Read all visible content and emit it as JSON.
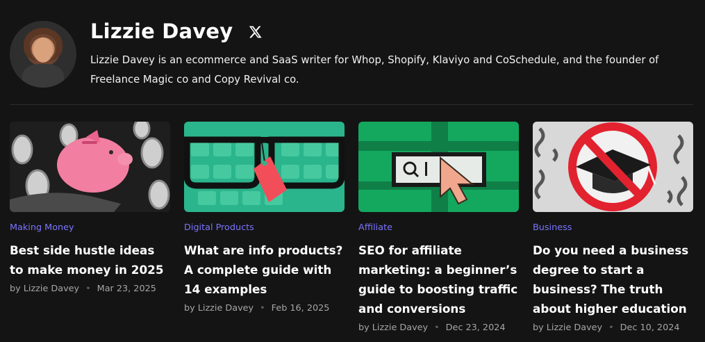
{
  "author": {
    "name": "Lizzie Davey",
    "bio": "Lizzie Davey is an ecommerce and SaaS writer for Whop, Shopify, Klaviyo and CoSchedule, and the founder of Freelance Magic co and Copy Revival co.",
    "social_icon": "x-icon"
  },
  "posts": [
    {
      "category": "Making Money",
      "title": "Best side hustle ideas to make money in 2025",
      "author": "by Lizzie Davey",
      "separator": "•",
      "date": "Mar 23, 2025",
      "image": "piggy-bank-illustration"
    },
    {
      "category": "Digital Products",
      "title": "What are info products? A complete guide with 14 examples",
      "author": "by Lizzie Davey",
      "separator": "•",
      "date": "Feb 16, 2025",
      "image": "glasses-keyboard-illustration"
    },
    {
      "category": "Affiliate",
      "title": "SEO for affiliate marketing: a beginner’s guide to boosting traffic and conversions",
      "author": "by Lizzie Davey",
      "separator": "•",
      "date": "Dec 23, 2024",
      "image": "search-cursor-illustration"
    },
    {
      "category": "Business",
      "title": "Do you need a business degree to start a business? The truth about higher education",
      "author": "by Lizzie Davey",
      "separator": "•",
      "date": "Dec 10, 2024",
      "image": "no-graduation-cap-illustration"
    }
  ],
  "colors": {
    "background": "#141414",
    "accent": "#7b74ff",
    "meta": "#a6a6a6"
  }
}
